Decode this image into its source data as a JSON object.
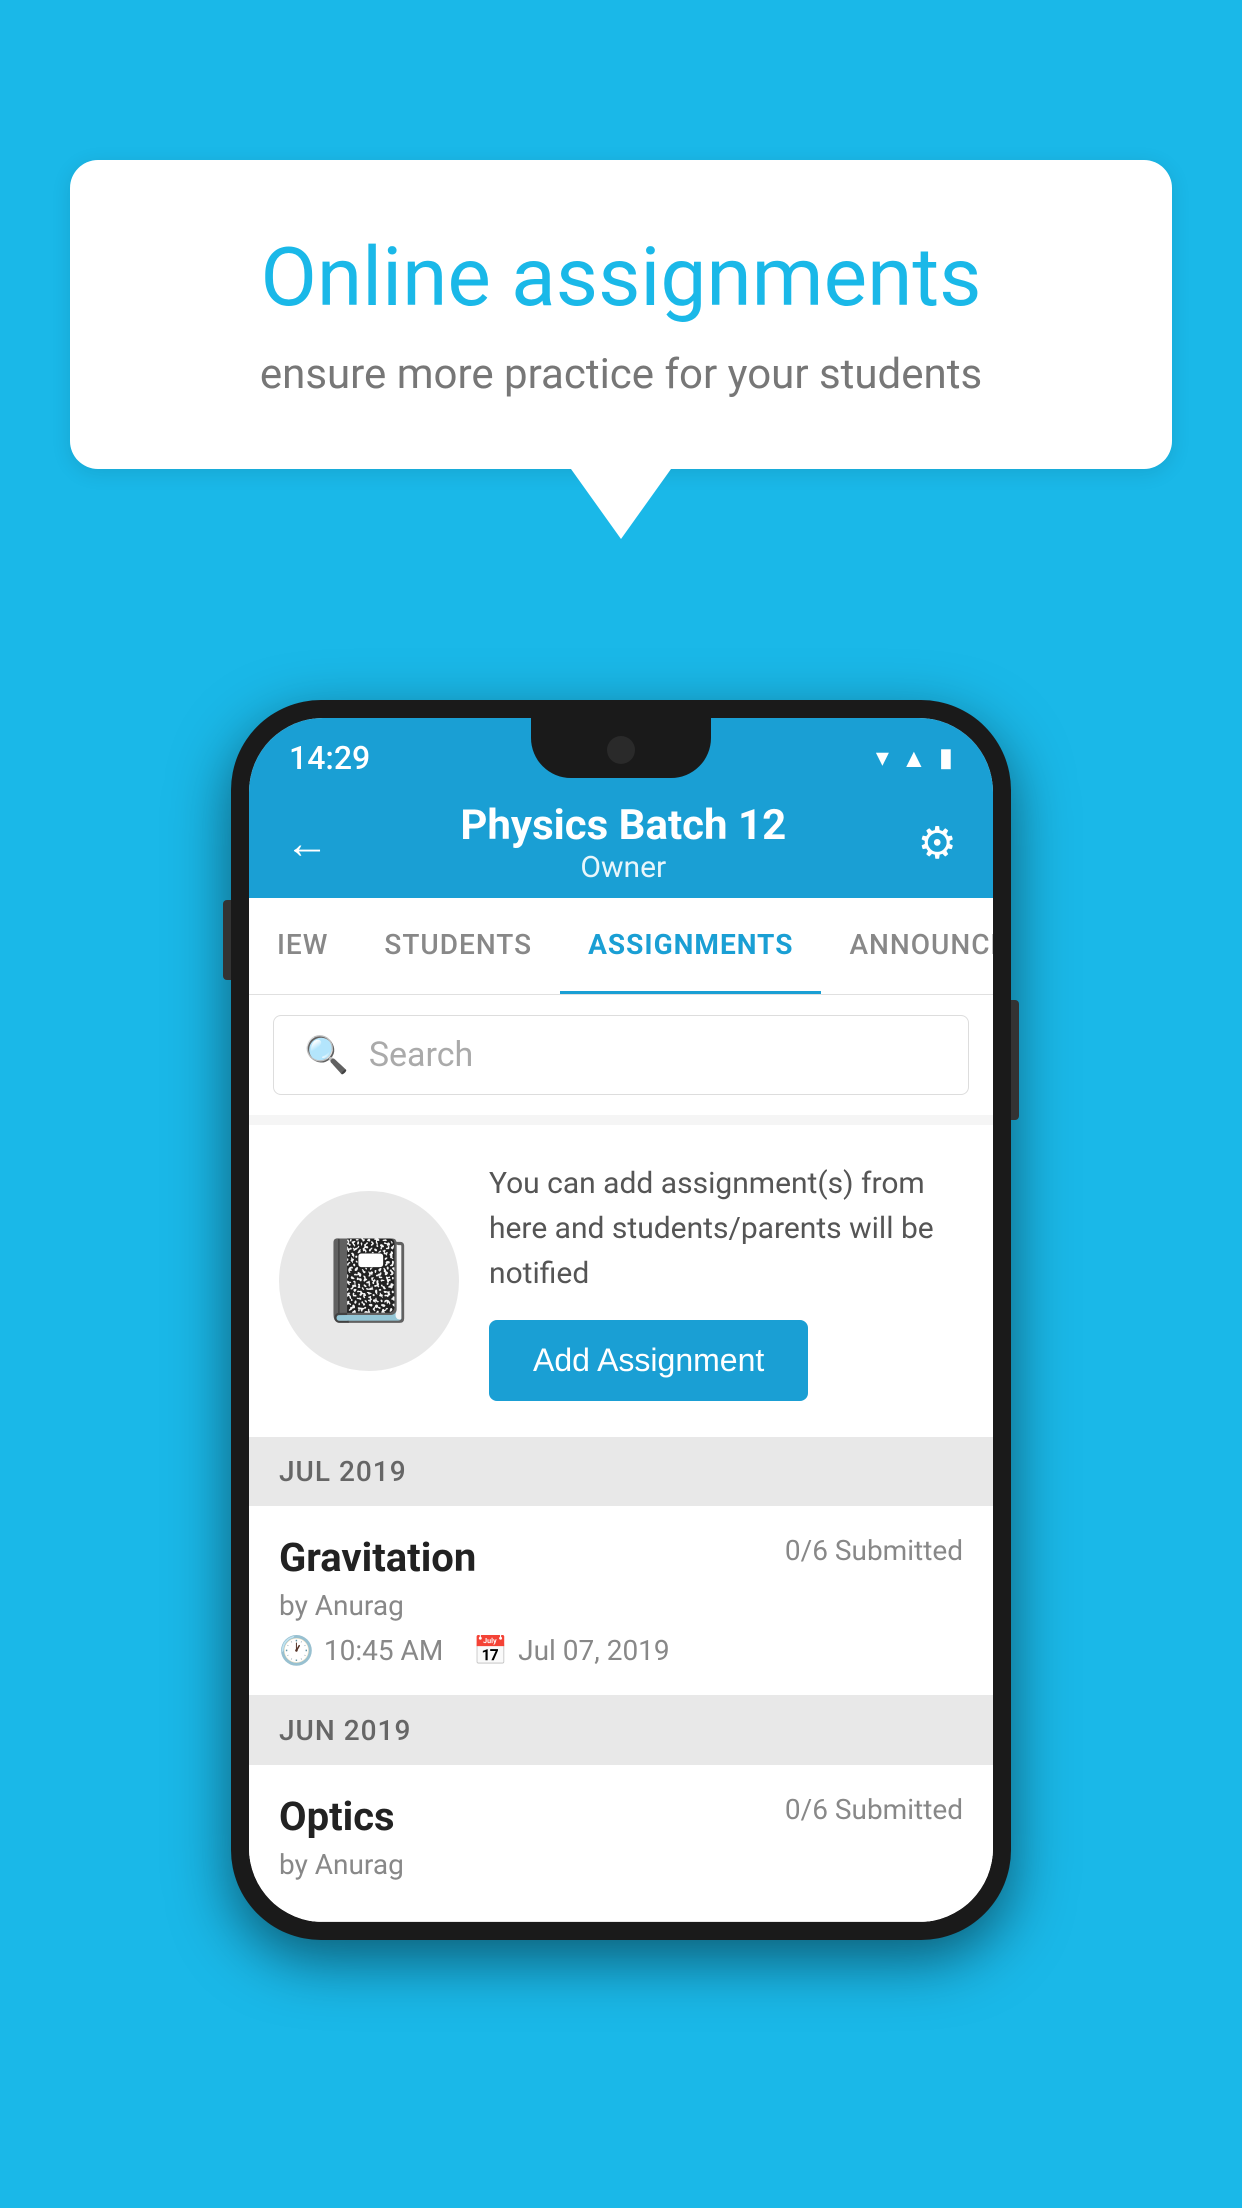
{
  "background": {
    "color": "#1ab8e8"
  },
  "speech_bubble": {
    "title": "Online assignments",
    "subtitle": "ensure more practice for your students"
  },
  "status_bar": {
    "time": "14:29",
    "icons": [
      "wifi",
      "signal",
      "battery"
    ]
  },
  "app_bar": {
    "title": "Physics Batch 12",
    "subtitle": "Owner",
    "back_icon": "←",
    "settings_icon": "⚙"
  },
  "tabs": [
    {
      "label": "IEW",
      "active": false
    },
    {
      "label": "STUDENTS",
      "active": false
    },
    {
      "label": "ASSIGNMENTS",
      "active": true
    },
    {
      "label": "ANNOUNCEMENTS",
      "active": false
    }
  ],
  "search": {
    "placeholder": "Search"
  },
  "promo": {
    "text": "You can add assignment(s) from here and students/parents will be notified",
    "button_label": "Add Assignment"
  },
  "sections": [
    {
      "header": "JUL 2019",
      "assignments": [
        {
          "name": "Gravitation",
          "submitted": "0/6 Submitted",
          "author": "by Anurag",
          "time": "10:45 AM",
          "date": "Jul 07, 2019"
        }
      ]
    },
    {
      "header": "JUN 2019",
      "assignments": [
        {
          "name": "Optics",
          "submitted": "0/6 Submitted",
          "author": "by Anurag",
          "time": "",
          "date": ""
        }
      ]
    }
  ]
}
